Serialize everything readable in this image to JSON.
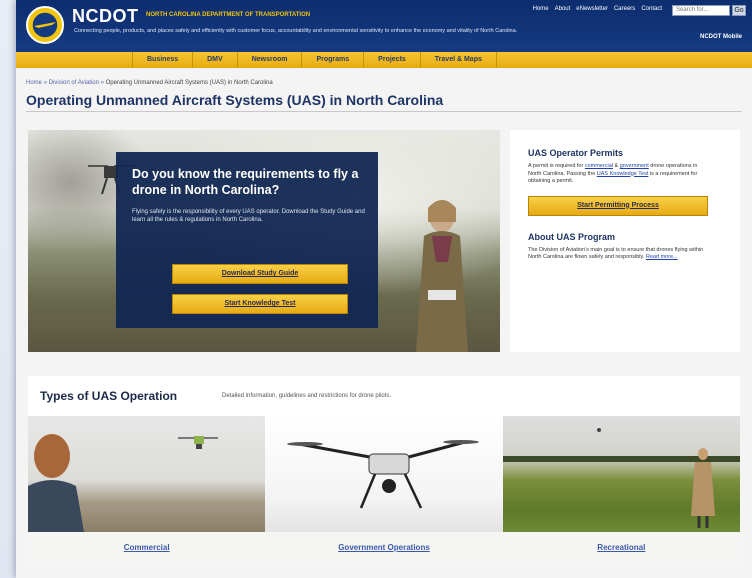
{
  "header": {
    "logo_text": "NCDOT",
    "dept_name": "NORTH CAROLINA DEPARTMENT OF TRANSPORTATION",
    "tagline": "Connecting people, products, and places safely and efficiently with customer focus, accountability and environmental sensitivity to enhance the economy and vitality of North Carolina.",
    "top_links": [
      "Home",
      "About",
      "eNewsletter",
      "Careers",
      "Contact"
    ],
    "search_placeholder": "Search for...",
    "search_button": "Go",
    "mobile_link": "NCDOT Mobile"
  },
  "nav": {
    "items": [
      "Business",
      "DMV",
      "Newsroom",
      "Programs",
      "Projects",
      "Travel & Maps"
    ]
  },
  "breadcrumb": {
    "items": [
      "Home",
      "Division of Aviation"
    ],
    "current": "Operating Unmanned Aircraft Systems (UAS) in North Carolina",
    "separator": "»"
  },
  "page_title": "Operating Unmanned Aircraft Systems (UAS) in North Carolina",
  "hero": {
    "heading": "Do you know the requirements to fly a drone in North Carolina?",
    "body": "Flying safely is the responsibility of every UAS operator. Download the Study Guide and learn all the rules & regulations in North Carolina.",
    "btn_guide": "Download Study Guide",
    "btn_test": "Start Knowledge Test"
  },
  "sidebar": {
    "permits_title": "UAS Operator Permits",
    "permits_text_1": "A permit is required for ",
    "permits_link_commercial": "commercial",
    "permits_text_2": " & ",
    "permits_link_government": "government",
    "permits_text_3": " drone operations in North Carolina. Passing the ",
    "permits_link_test": "UAS Knowledge Test",
    "permits_text_4": " is a requirement for obtaining a permit.",
    "permits_btn": "Start Permitting Process",
    "about_title": "About UAS Program",
    "about_text": "The Division of Aviation's main goal is to ensure that drones flying within North Carolina are flown safely and responsibly.",
    "about_link": "Read more..."
  },
  "types": {
    "title": "Types of UAS Operation",
    "desc": "Detailed information, guidelines and restrictions for drone pilots.",
    "tiles": [
      {
        "label": "Commercial"
      },
      {
        "label": "Government Operations"
      },
      {
        "label": "Recreational"
      }
    ]
  },
  "colors": {
    "header_blue": "#0c2d6e",
    "nav_gold": "#f1c40f",
    "title_blue": "#1e3466",
    "link_blue": "#3b5aa8"
  }
}
